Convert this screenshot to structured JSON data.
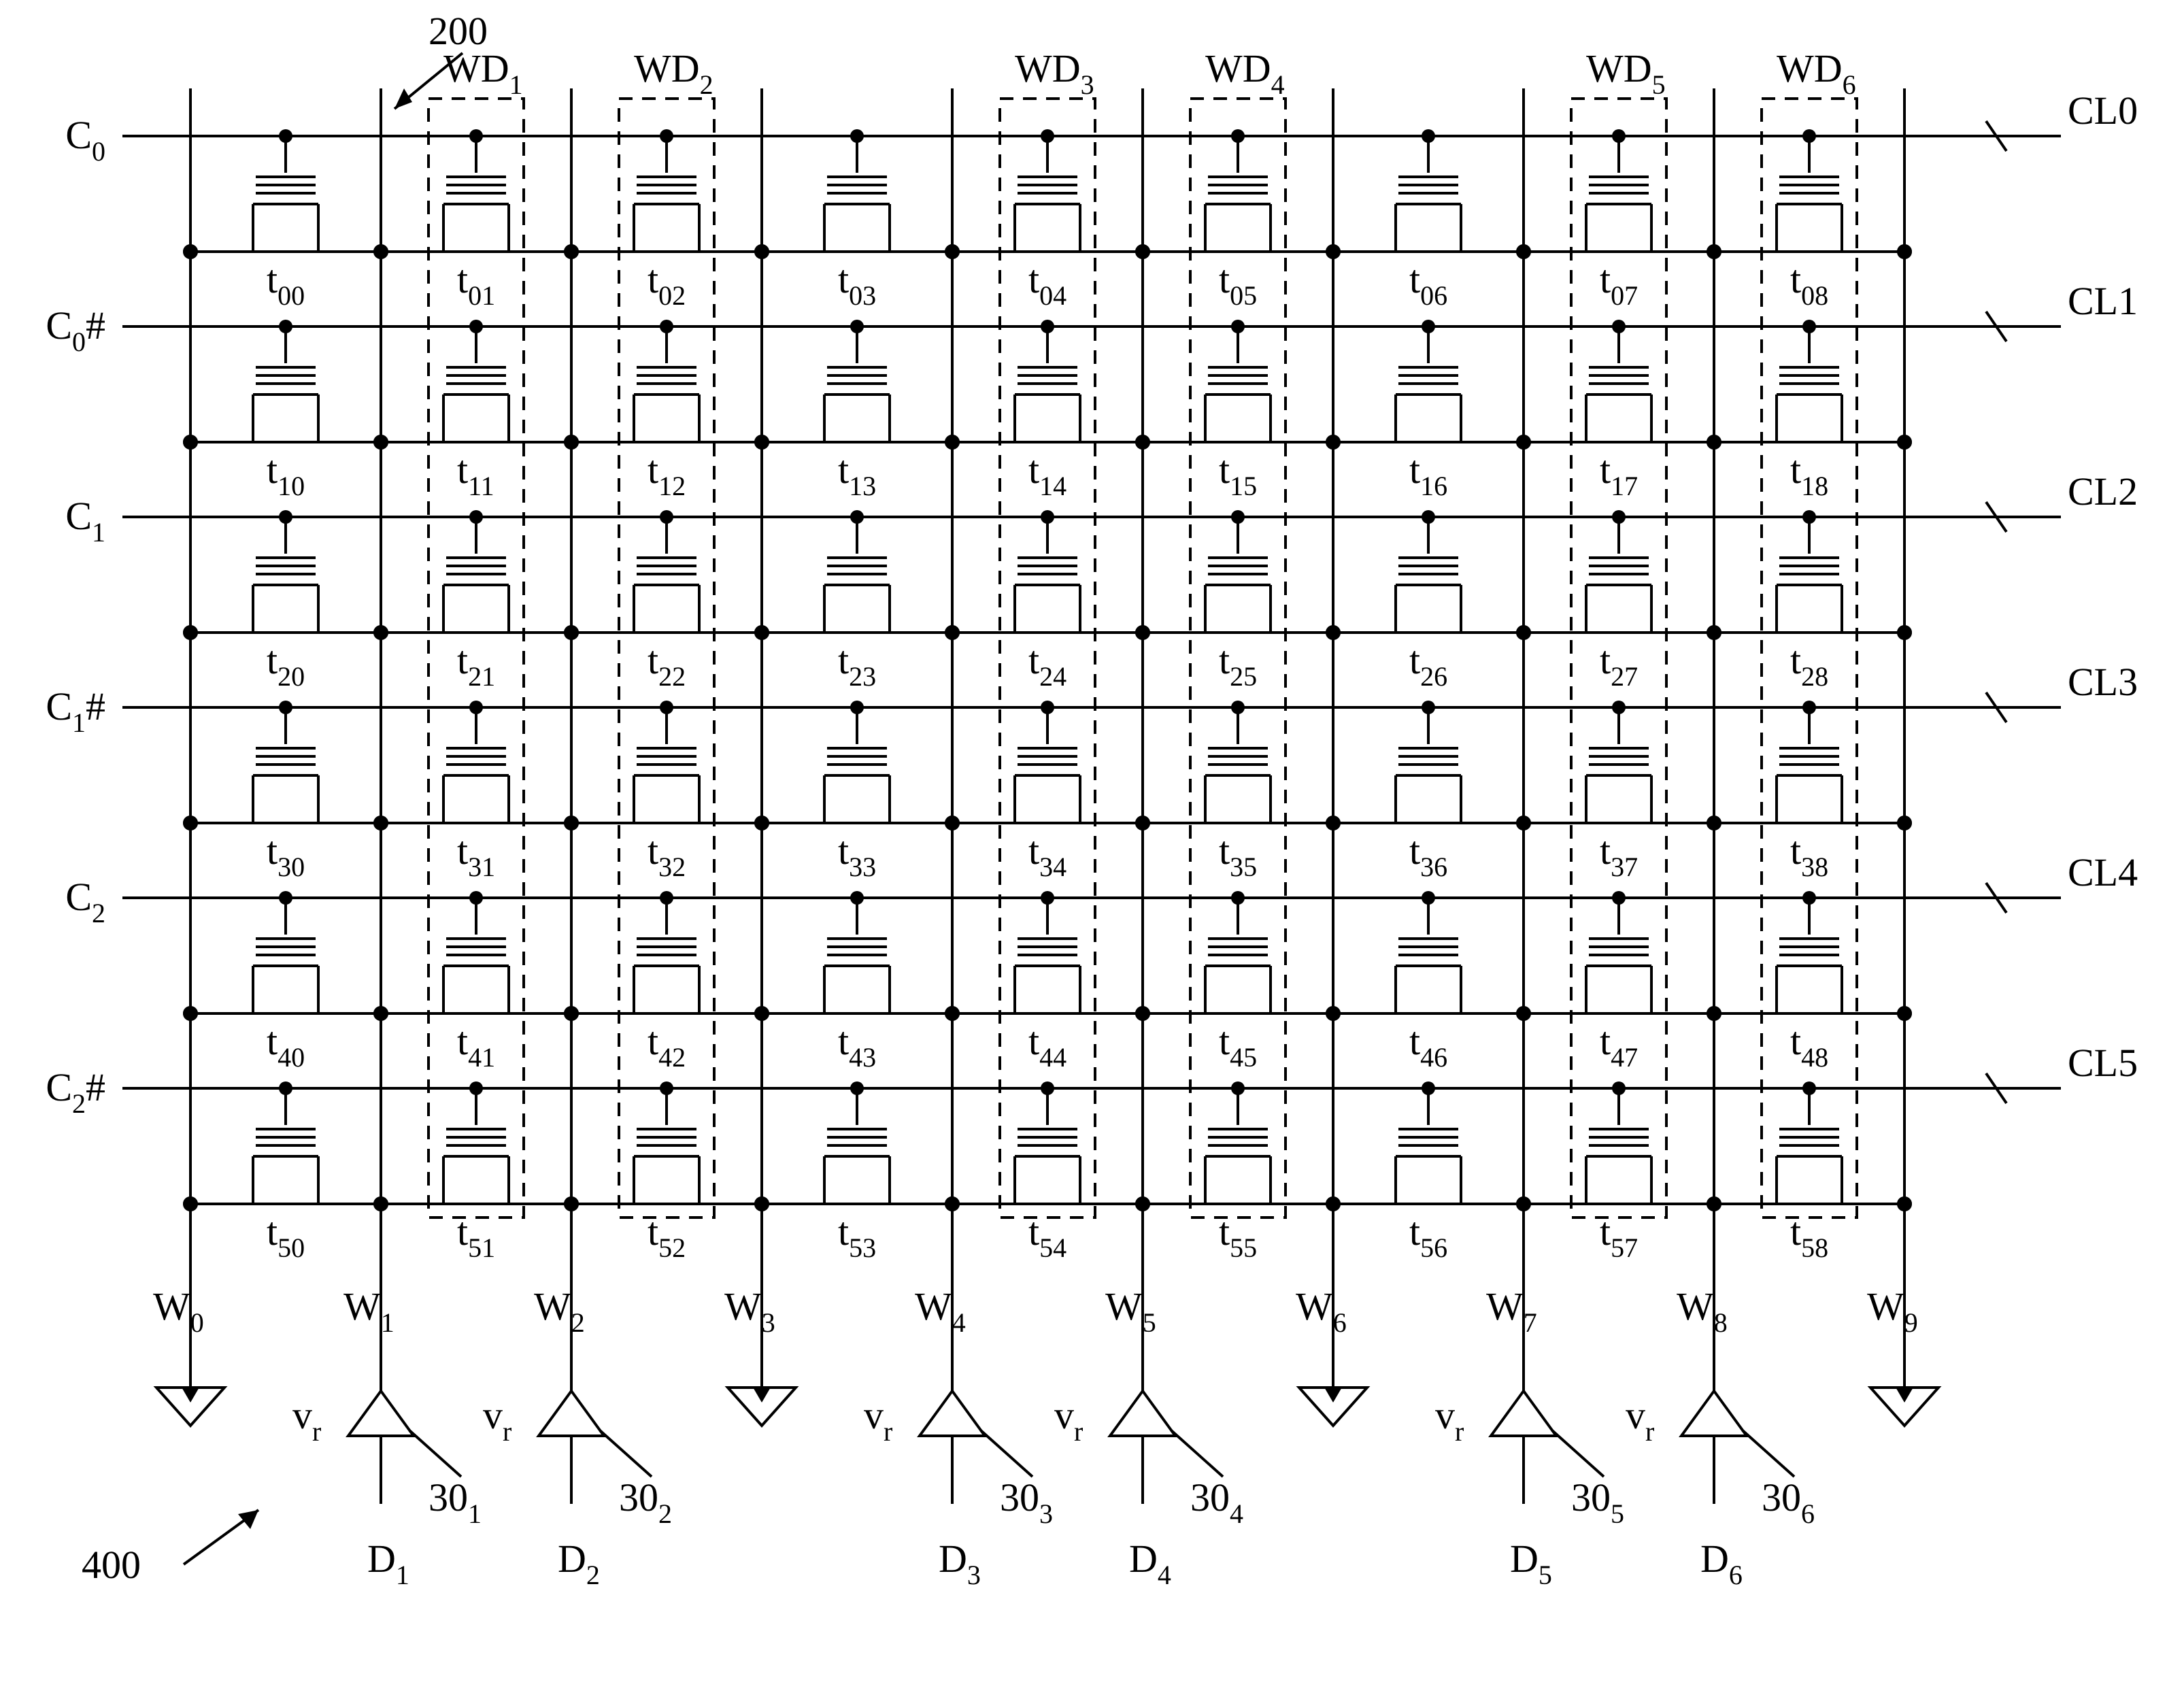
{
  "fig_ref": "400",
  "callout": "200",
  "control_lines": [
    "CL0",
    "CL1",
    "CL2",
    "CL3",
    "CL4",
    "CL5"
  ],
  "row_labels": [
    "C0",
    "C0#",
    "C1",
    "C1#",
    "C2",
    "C2#"
  ],
  "writedriver_labels": [
    "WD1",
    "WD2",
    "WD3",
    "WD4",
    "WD5",
    "WD6"
  ],
  "column_labels": [
    "W0",
    "W1",
    "W2",
    "W3",
    "W4",
    "W5",
    "W6",
    "W7",
    "W8",
    "W9"
  ],
  "columns": [
    {
      "type": "sink"
    },
    {
      "type": "driver",
      "v": "vr",
      "num": "301",
      "d": "D1"
    },
    {
      "type": "driver",
      "v": "vr",
      "num": "302",
      "d": "D2"
    },
    {
      "type": "sink"
    },
    {
      "type": "driver",
      "v": "vr",
      "num": "303",
      "d": "D3"
    },
    {
      "type": "driver",
      "v": "vr",
      "num": "304",
      "d": "D4"
    },
    {
      "type": "sink"
    },
    {
      "type": "driver",
      "v": "vr",
      "num": "305",
      "d": "D5"
    },
    {
      "type": "driver",
      "v": "vr",
      "num": "306",
      "d": "D6"
    },
    {
      "type": "sink"
    }
  ],
  "transistor_prefix": "t",
  "grid_cols": 9,
  "grid_rows": 6
}
